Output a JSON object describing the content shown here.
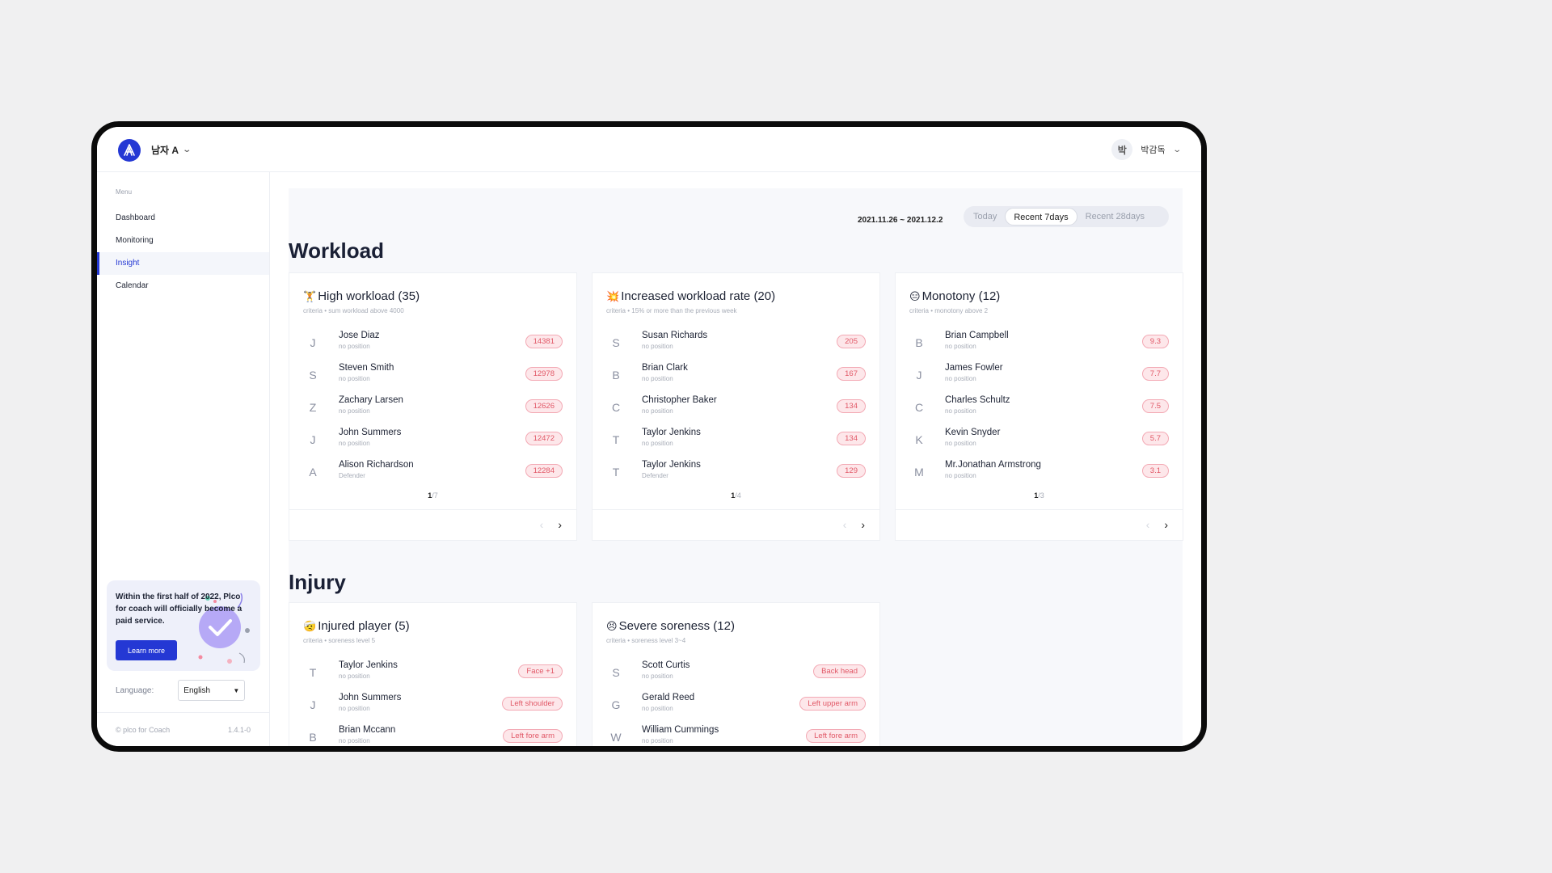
{
  "header": {
    "team_name": "남자 A",
    "user_initial": "박",
    "user_name": "박감독"
  },
  "sidebar": {
    "menu_label": "Menu",
    "items": [
      {
        "label": "Dashboard"
      },
      {
        "label": "Monitoring"
      },
      {
        "label": "Insight"
      },
      {
        "label": "Calendar"
      }
    ],
    "promo_text": "Within the first half of 2022, Plco for coach will officially become a paid service.",
    "promo_button": "Learn more",
    "language_label": "Language:",
    "language_value": "English",
    "footer_left": "© plco for Coach",
    "footer_right": "1.4.1-0"
  },
  "filters": {
    "date_range": "2021.11.26 ~ 2021.12.2",
    "segments": [
      "Today",
      "Recent 7days",
      "Recent 28days"
    ],
    "selected": "Recent 7days"
  },
  "workload": {
    "title": "Workload",
    "cards": [
      {
        "emoji": "🏋",
        "title": "High workload (35)",
        "criteria": "criteria  •  sum workload above 4000",
        "page": "1",
        "pages": "/7",
        "rows": [
          {
            "initial": "J",
            "name": "Jose Diaz",
            "position": "no position",
            "value": "14381"
          },
          {
            "initial": "S",
            "name": "Steven Smith",
            "position": "no position",
            "value": "12978"
          },
          {
            "initial": "Z",
            "name": "Zachary Larsen",
            "position": "no position",
            "value": "12626"
          },
          {
            "initial": "J",
            "name": "John Summers",
            "position": "no position",
            "value": "12472"
          },
          {
            "initial": "A",
            "name": "Alison Richardson",
            "position": "Defender",
            "value": "12284"
          }
        ]
      },
      {
        "emoji": "💥",
        "title": "Increased workload rate (20)",
        "criteria": "criteria  •  15% or more than the previous week",
        "page": "1",
        "pages": "/4",
        "rows": [
          {
            "initial": "S",
            "name": "Susan Richards",
            "position": "no position",
            "value": "205"
          },
          {
            "initial": "B",
            "name": "Brian Clark",
            "position": "no position",
            "value": "167"
          },
          {
            "initial": "C",
            "name": "Christopher Baker",
            "position": "no position",
            "value": "134"
          },
          {
            "initial": "T",
            "name": "Taylor Jenkins",
            "position": "no position",
            "value": "134"
          },
          {
            "initial": "T",
            "name": "Taylor Jenkins",
            "position": "Defender",
            "value": "129"
          }
        ]
      },
      {
        "emoji": "😑",
        "title": "Monotony (12)",
        "criteria": "criteria  •  monotony above 2",
        "page": "1",
        "pages": "/3",
        "rows": [
          {
            "initial": "B",
            "name": "Brian Campbell",
            "position": "no position",
            "value": "9.3"
          },
          {
            "initial": "J",
            "name": "James Fowler",
            "position": "no position",
            "value": "7.7"
          },
          {
            "initial": "C",
            "name": "Charles Schultz",
            "position": "no position",
            "value": "7.5"
          },
          {
            "initial": "K",
            "name": "Kevin Snyder",
            "position": "no position",
            "value": "5.7"
          },
          {
            "initial": "M",
            "name": "Mr.Jonathan Armstrong",
            "position": "no position",
            "value": "3.1"
          }
        ]
      }
    ]
  },
  "injury": {
    "title": "Injury",
    "cards": [
      {
        "emoji": "🤕",
        "title": "Injured player (5)",
        "criteria": "criteria  •  soreness level 5",
        "rows": [
          {
            "initial": "T",
            "name": "Taylor Jenkins",
            "position": "no position",
            "value": "Face +1"
          },
          {
            "initial": "J",
            "name": "John Summers",
            "position": "no position",
            "value": "Left shoulder"
          },
          {
            "initial": "B",
            "name": "Brian Mccann",
            "position": "no position",
            "value": "Left fore arm"
          }
        ]
      },
      {
        "emoji": "😣",
        "title": "Severe soreness (12)",
        "criteria": "criteria  •  soreness level 3~4",
        "rows": [
          {
            "initial": "S",
            "name": "Scott Curtis",
            "position": "no position",
            "value": "Back head"
          },
          {
            "initial": "G",
            "name": "Gerald Reed",
            "position": "no position",
            "value": "Left upper arm"
          },
          {
            "initial": "W",
            "name": "William Cummings",
            "position": "no position",
            "value": "Left fore arm"
          }
        ]
      }
    ]
  }
}
